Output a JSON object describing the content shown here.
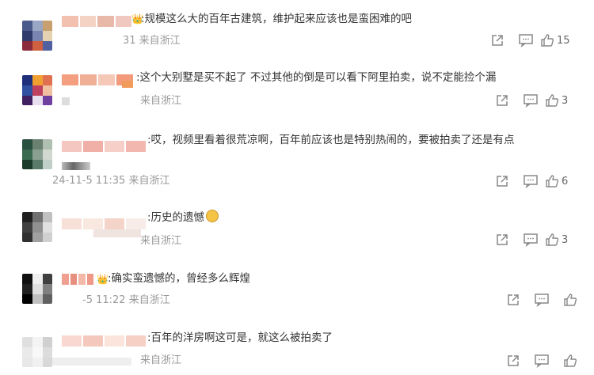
{
  "comments": [
    {
      "text": ":规模这么大的百年古建筑，维护起来应该也是蛮困难的吧",
      "meta": "31 来自浙江",
      "likes": "15",
      "badge_icon": "crown-badge-icon",
      "avatar_colors": [
        "#4a5a8a",
        "#9aa6c4",
        "#c8a070",
        "#2e3b6b",
        "#7a86b0",
        "#e4d2b0",
        "#8a2a3a",
        "#d06040",
        "#5060a0"
      ],
      "nick_colors": [
        "#f2c1b0",
        "#f4d2c4",
        "#e8b8a8",
        "#f0c8c0"
      ]
    },
    {
      "text": ":这个大别墅是买不起了 不过其他的倒是可以看下阿里拍卖，说不定能捡个漏",
      "meta": "来自浙江",
      "likes": "3",
      "badge_icon": "orange-badge-icon",
      "avatar_colors": [
        "#1f2f7a",
        "#f0a030",
        "#e07050",
        "#3050a0",
        "#c04060",
        "#f0c0a0",
        "#402060",
        "#e8e0f0",
        "#7040a0"
      ],
      "nick_colors": [
        "#f4a080",
        "#f0b098",
        "#f6c8b8",
        "#f29a7a"
      ]
    },
    {
      "text": ":哎，视频里看着很荒凉啊，百年前应该也是特别热闹的，要被拍卖了还是有点",
      "meta": "24-11-5 11:35 来自浙江",
      "likes": "6",
      "badge_icon": "",
      "avatar_colors": [
        "#2a5040",
        "#6a8070",
        "#b0c0b0",
        "#3a6a50",
        "#8aa090",
        "#d0d8d0",
        "#1a3a2a",
        "#5a7a6a",
        "#c0d0c8"
      ],
      "nick_colors": [
        "#f4c8c0",
        "#f0b0a8",
        "#f6d0c8",
        "#f2b8b0"
      ]
    },
    {
      "text": ":历史的遗憾",
      "meta": "来自浙江",
      "likes": "3",
      "badge_icon": "sad-face-emoji-icon",
      "avatar_colors": [
        "#202020",
        "#707070",
        "#c0c0c0",
        "#404040",
        "#909090",
        "#e0e0e0",
        "#303030",
        "#a0a0a0",
        "#d0d0d0"
      ],
      "nick_colors": [
        "#f6e0d8",
        "#f8e8e0",
        "#f4d4c8",
        "#f8ece8"
      ]
    },
    {
      "text": ":确实蛮遗憾的，曾经多么辉煌",
      "meta": "-5 11:22 来自浙江",
      "likes": "",
      "badge_icon": "crown-badge-icon",
      "avatar_colors": [
        "#101010",
        "#f0f0f0",
        "#404040",
        "#202020",
        "#e0e0e0",
        "#808080",
        "#000000",
        "#c0c0c0",
        "#606060"
      ],
      "nick_colors": [
        "#f0a090",
        "#e89080",
        "#f4b8a8",
        "#ee9888"
      ]
    },
    {
      "text": ":百年的洋房啊这可是，就这么被拍卖了",
      "meta": "来自浙江",
      "likes": "",
      "badge_icon": "",
      "avatar_colors": [
        "#e0e0e0",
        "#f4f4f4",
        "#d0d0d0",
        "#eaeaea",
        "#f8f8f8",
        "#dcdcdc",
        "#e8e8e8",
        "#f0f0f0",
        "#d8d8d8"
      ],
      "nick_colors": [
        "#f8d8d0",
        "#f4c8bc",
        "#fae4dc",
        "#f6d0c4"
      ]
    }
  ]
}
